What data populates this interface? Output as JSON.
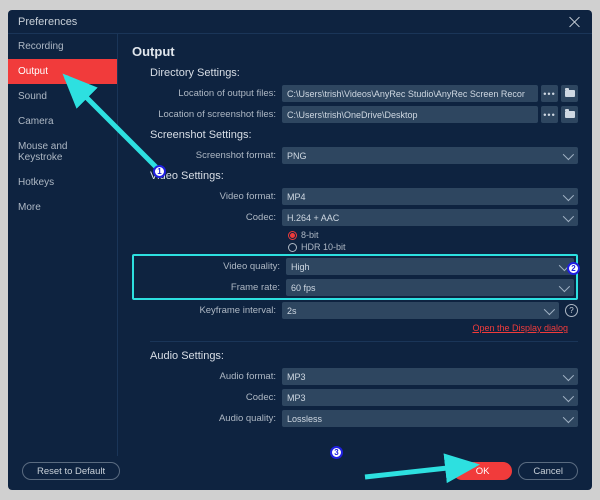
{
  "title": "Preferences",
  "sidebar": {
    "items": [
      {
        "label": "Recording"
      },
      {
        "label": "Output"
      },
      {
        "label": "Sound"
      },
      {
        "label": "Camera"
      },
      {
        "label": "Mouse and Keystroke"
      },
      {
        "label": "Hotkeys"
      },
      {
        "label": "More"
      }
    ],
    "active_index": 1
  },
  "heading": "Output",
  "sections": {
    "directory": {
      "title": "Directory Settings:",
      "output_files_label": "Location of output files:",
      "output_files_value": "C:\\Users\\trish\\Videos\\AnyRec Studio\\AnyRec Screen Recor",
      "screenshot_files_label": "Location of screenshot files:",
      "screenshot_files_value": "C:\\Users\\trish\\OneDrive\\Desktop"
    },
    "screenshot": {
      "title": "Screenshot Settings:",
      "format_label": "Screenshot format:",
      "format_value": "PNG"
    },
    "video": {
      "title": "Video Settings:",
      "format_label": "Video format:",
      "format_value": "MP4",
      "codec_label": "Codec:",
      "codec_value": "H.264 + AAC",
      "bit8_label": "8-bit",
      "hdr_label": "HDR 10-bit",
      "quality_label": "Video quality:",
      "quality_value": "High",
      "framerate_label": "Frame rate:",
      "framerate_value": "60 fps",
      "keyframe_label": "Keyframe interval:",
      "keyframe_value": "2s",
      "display_link": "Open the Display dialog"
    },
    "audio": {
      "title": "Audio Settings:",
      "format_label": "Audio format:",
      "format_value": "MP3",
      "codec_label": "Codec:",
      "codec_value": "MP3",
      "quality_label": "Audio quality:",
      "quality_value": "Lossless"
    }
  },
  "footer": {
    "reset_label": "Reset to Default",
    "ok_label": "OK",
    "cancel_label": "Cancel"
  },
  "annotations": {
    "badge1": "1",
    "badge2": "2",
    "badge3": "3"
  }
}
